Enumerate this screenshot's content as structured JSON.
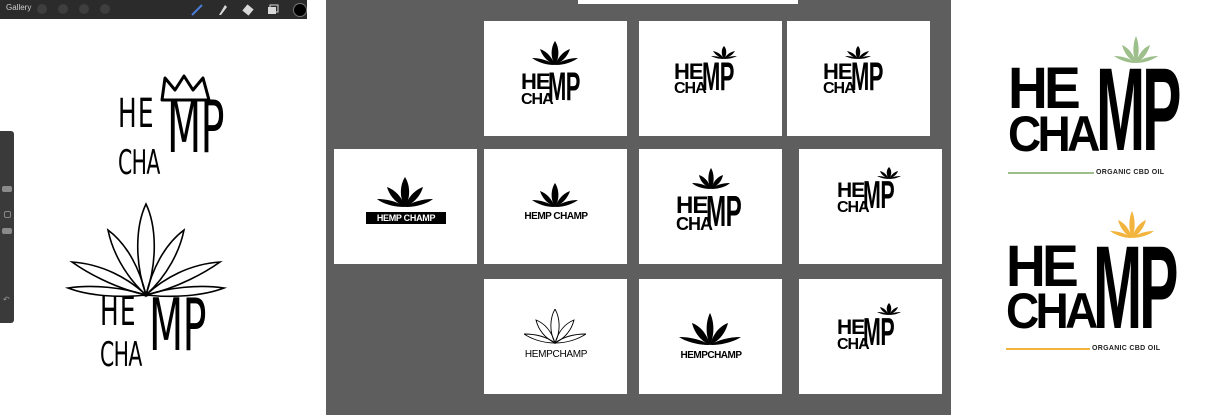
{
  "app": {
    "toolbar": {
      "gallery_label": "Gallery"
    }
  },
  "brand": {
    "word_top": "HE",
    "word_m": "MP",
    "word_bottom": "CHA",
    "inline_name": "HEMP CHAMP",
    "inline_name_tight": "HEMPCHAMP",
    "tagline": "ORGANIC CBD OIL"
  },
  "colors": {
    "canvas_bg": "#5e5e5e",
    "toolbar_bg": "#2b2b2b",
    "accent_green": "#9dbf8b",
    "accent_orange": "#f2b43c"
  },
  "icons": [
    "wrench-icon",
    "magic-wand-icon",
    "selection-icon",
    "transform-icon",
    "brush-icon",
    "smudge-icon",
    "eraser-icon",
    "layers-icon",
    "color-swatch-icon",
    "undo-icon"
  ]
}
